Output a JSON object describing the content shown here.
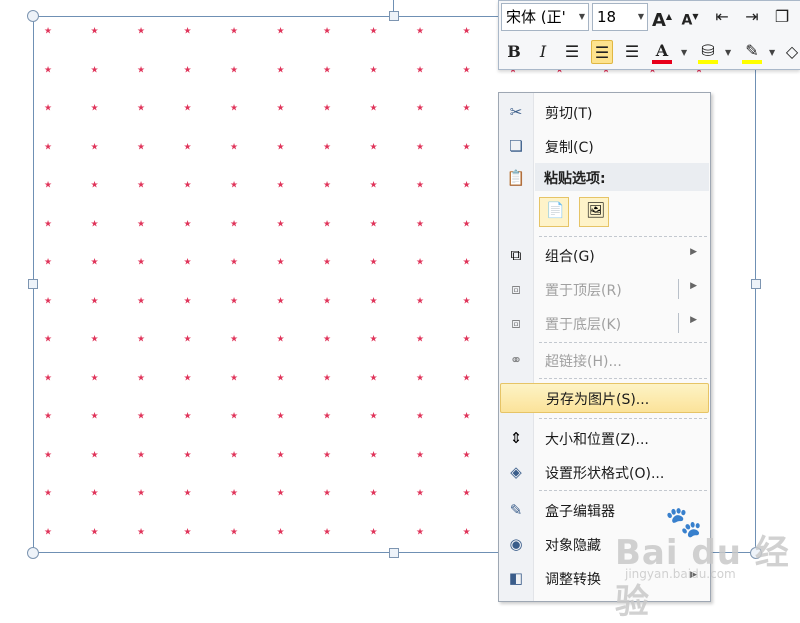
{
  "colors": {
    "star": "#e0345a",
    "selection_border": "#6f90b4",
    "highlight": "#fbe39a",
    "text_dark": "#1a1a1a",
    "text_disabled": "#a0a0a0"
  },
  "mini_toolbar": {
    "font_name": "宋体 (正'",
    "font_size": "18",
    "grow_font_label": "A",
    "shrink_font_label": "A",
    "bold_label": "B",
    "italic_label": "I",
    "font_color_label": "A",
    "icons": {
      "grow": "grow-font-icon",
      "shrink": "shrink-font-icon",
      "indent_decrease": "decrease-indent-icon",
      "indent_increase": "increase-indent-icon",
      "shape": "shape-icon",
      "align_left": "align-left-icon",
      "align_center": "align-center-icon",
      "align_right": "align-right-icon",
      "fill": "paint-bucket-icon",
      "outline": "pen-outline-icon",
      "eraser": "eraser-icon"
    }
  },
  "context_menu": {
    "items": [
      {
        "label": "剪切(T)",
        "icon": "scissors-icon",
        "disabled": false
      },
      {
        "label": "复制(C)",
        "icon": "copy-icon",
        "disabled": false
      },
      {
        "label": "粘贴选项:",
        "icon": "clipboard-icon",
        "disabled": false,
        "header": true
      },
      {
        "label": "组合(G)",
        "icon": "group-icon",
        "disabled": false,
        "submenu": true
      },
      {
        "label": "置于顶层(R)",
        "icon": "bring-front-icon",
        "disabled": true,
        "submenu": true
      },
      {
        "label": "置于底层(K)",
        "icon": "send-back-icon",
        "disabled": true,
        "submenu": true
      },
      {
        "label": "超链接(H)...",
        "icon": "hyperlink-icon",
        "disabled": true
      },
      {
        "label": "另存为图片(S)...",
        "icon": "none",
        "disabled": false,
        "highlighted": true
      },
      {
        "label": "大小和位置(Z)...",
        "icon": "size-position-icon",
        "disabled": false
      },
      {
        "label": "设置形状格式(O)...",
        "icon": "format-shape-icon",
        "disabled": false
      },
      {
        "label": "盒子编辑器",
        "icon": "edit-icon",
        "disabled": false
      },
      {
        "label": "对象隐藏",
        "icon": "hide-eye-icon",
        "disabled": false
      },
      {
        "label": "调整转换",
        "icon": "transform-icon",
        "disabled": false,
        "submenu": true
      }
    ],
    "paste_options": [
      "paste-keep-icon",
      "paste-picture-icon"
    ]
  },
  "watermark": {
    "brand": "Bai du 经验",
    "url": "jingyan.baidu.com"
  }
}
